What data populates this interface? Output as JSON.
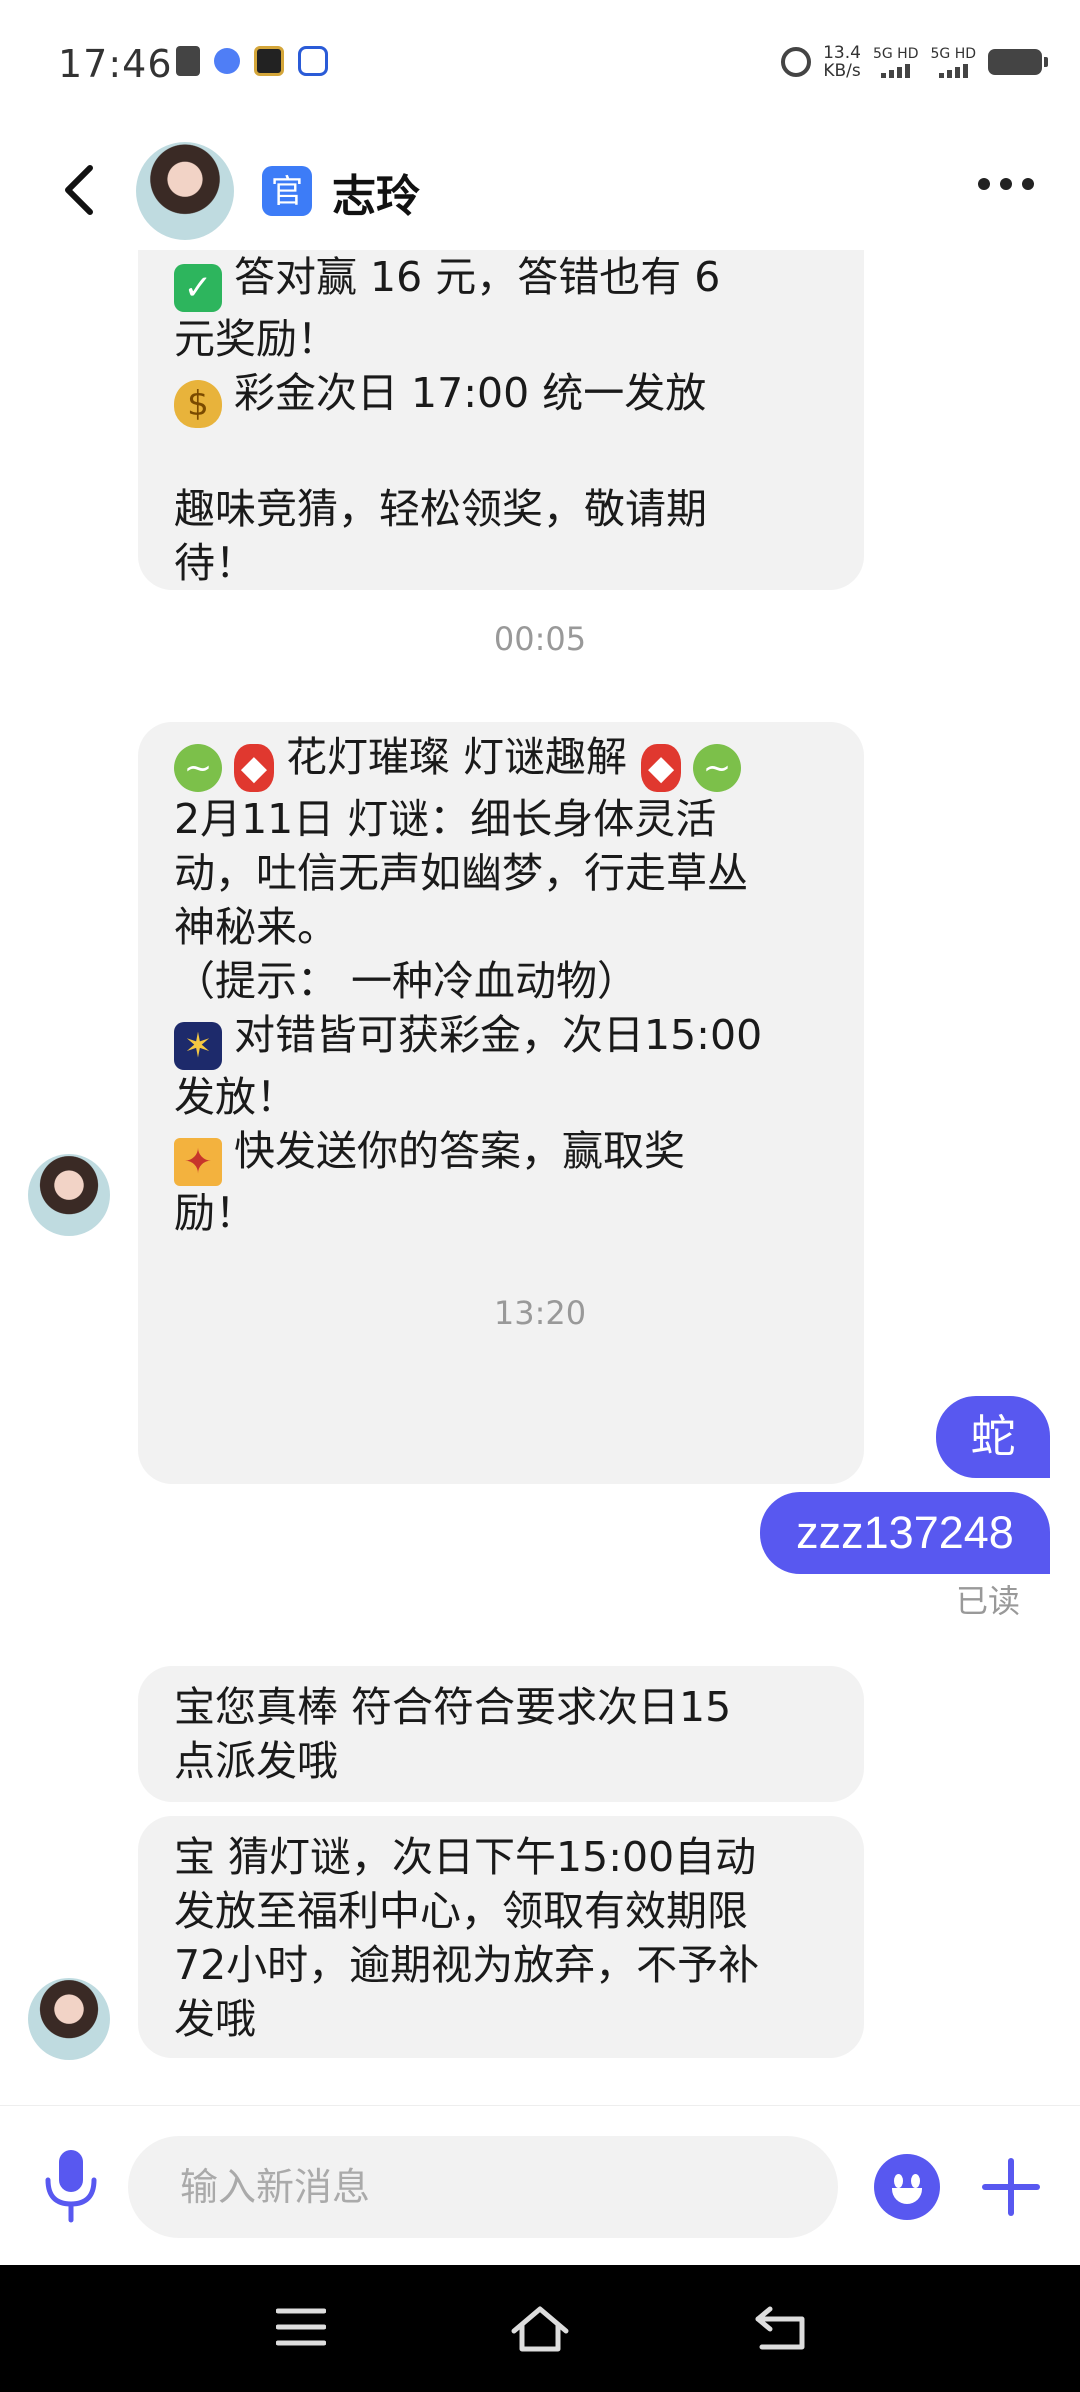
{
  "status_bar": {
    "time": "17:46",
    "net_speed_value": "13.4",
    "net_speed_unit": "KB/s",
    "sim1_label": "5G HD",
    "sim2_label": "5G HD"
  },
  "header": {
    "official_badge": "官",
    "contact_name": "志玲"
  },
  "messages": {
    "m1": {
      "line1": "答对赢 16 元，答错也有 6",
      "line2": "元奖励！",
      "line3": "彩金次日 17:00 统一发放",
      "line4": "趣味竞猜，轻松领奖，敬请期",
      "line5": "待！"
    },
    "ts1": "00:05",
    "m2": {
      "line1": "花灯璀璨 灯谜趣解",
      "line2": "2月11日 灯谜：细长身体灵活",
      "line3": "动，吐信无声如幽梦，行走草丛",
      "line4": "神秘来。",
      "line5": "（提示： 一种冷血动物）",
      "line6": "对错皆可获彩金，次日15:00",
      "line7": "发放！",
      "line8": "快发送你的答案，赢取奖",
      "line9": "励！"
    },
    "ts2": "13:20",
    "out1": "蛇",
    "out2": "zzz137248",
    "read_status": "已读",
    "m3": {
      "line1": "宝您真棒 符合符合要求次日15",
      "line2": "点派发哦"
    },
    "m4": {
      "line1": "宝 猜灯谜，次日下午15:00自动",
      "line2": "发放至福利中心，领取有效期限",
      "line3": "72小时，逾期视为放弃，不予补",
      "line4": "发哦"
    }
  },
  "input": {
    "placeholder": "输入新消息"
  },
  "colors": {
    "accent": "#5858f0",
    "bubble_incoming": "#f2f2f2",
    "official_badge": "#3d7cf7"
  },
  "icons": {
    "back": "back-arrow-icon",
    "more": "more-dots-icon",
    "mic": "microphone-icon",
    "emoji": "emoji-smile-icon",
    "plus": "plus-icon",
    "nav_menu": "menu-icon",
    "nav_home": "home-icon",
    "nav_back": "back-nav-icon"
  }
}
